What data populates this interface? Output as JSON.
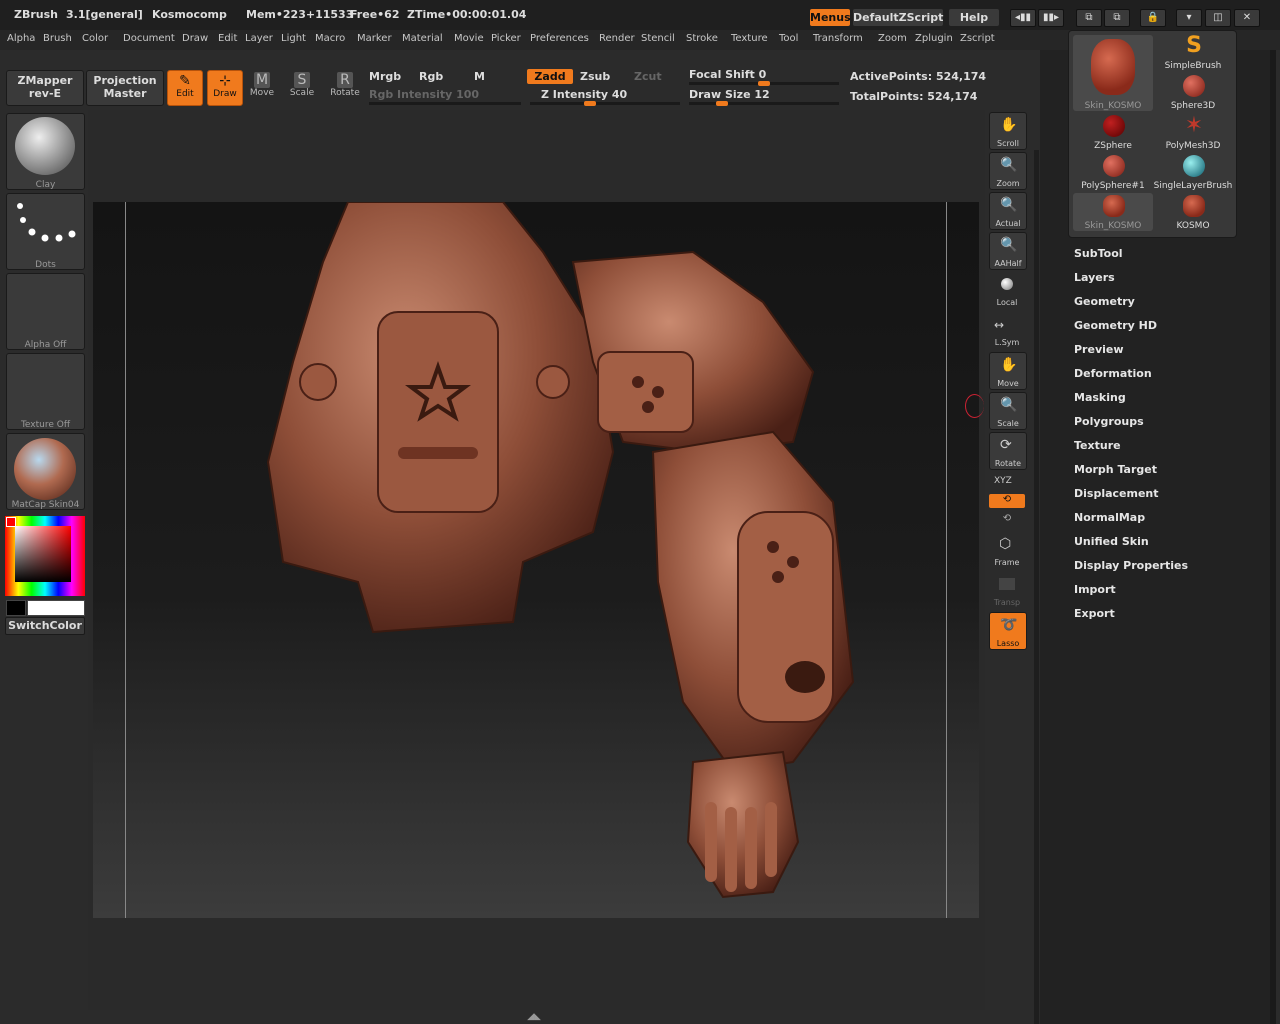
{
  "titlebar": {
    "app": "ZBrush",
    "version": "3.1[general]",
    "document": "Kosmocomp",
    "mem": "Mem•223+11533",
    "free": "Free•62",
    "ztime": "ZTime•00:00:01.04",
    "menus_btn": "Menus",
    "script_btn": "DefaultZScript",
    "help_btn": "Help"
  },
  "menubar": [
    "Alpha",
    "Brush",
    "Color",
    "Document",
    "Draw",
    "Edit",
    "Layer",
    "Light",
    "Macro",
    "Marker",
    "Material",
    "Movie",
    "Picker",
    "Preferences",
    "Render",
    "Stencil",
    "Stroke",
    "Texture",
    "Tool",
    "Transform",
    "Zoom",
    "Zplugin",
    "Zscript"
  ],
  "toolbar": {
    "zmapper_line1": "ZMapper",
    "zmapper_line2": "rev-E",
    "projection_line1": "Projection",
    "projection_line2": "Master",
    "edit": "Edit",
    "draw": "Draw",
    "move": "Move",
    "scale": "Scale",
    "rotate": "Rotate",
    "mrgb": "Mrgb",
    "rgb": "Rgb",
    "m": "M",
    "rgb_intensity": "Rgb Intensity 100",
    "zadd": "Zadd",
    "zsub": "Zsub",
    "zcut": "Zcut",
    "z_intensity": "Z Intensity 40",
    "focal_shift": "Focal Shift 0",
    "draw_size": "Draw Size 12",
    "active_points": "ActivePoints: 524,174",
    "total_points": "TotalPoints: 524,174"
  },
  "lefttray": {
    "brush": "Clay",
    "stroke": "Dots",
    "alpha": "Alpha Off",
    "texture": "Texture Off",
    "material": "MatCap Skin04",
    "switch_color": "SwitchColor"
  },
  "shelf": [
    "Scroll",
    "Zoom",
    "Actual",
    "AAHalf",
    "Local",
    "L.Sym",
    "Move",
    "Scale",
    "Rotate",
    "XYZ",
    "Frame",
    "Transp",
    "Lasso"
  ],
  "tool_popup": [
    {
      "label": "Skin_KOSMO",
      "icon": "model-thumbnail"
    },
    {
      "label": "SimpleBrush",
      "icon": "simplebrush-icon"
    },
    {
      "label": "Sphere3D",
      "icon": "sphere-icon"
    },
    {
      "label": "ZSphere",
      "icon": "zsphere-icon"
    },
    {
      "label": "PolyMesh3D",
      "icon": "star-icon"
    },
    {
      "label": "PolySphere#1",
      "icon": "sphere-icon"
    },
    {
      "label": "SingleLayerBrush",
      "icon": "sphere-icon"
    },
    {
      "label": "Skin_KOSMO",
      "icon": "model-thumbnail"
    },
    {
      "label": "KOSMO",
      "icon": "model-thumbnail"
    }
  ],
  "rightpanel": [
    "SubTool",
    "Layers",
    "Geometry",
    "Geometry HD",
    "Preview",
    "Deformation",
    "Masking",
    "Polygroups",
    "Texture",
    "Morph Target",
    "Displacement",
    "NormalMap",
    "Unified Skin",
    "Display Properties",
    "Import",
    "Export"
  ],
  "colors": {
    "accent": "#f07a1d",
    "model": "#9a5a44"
  }
}
